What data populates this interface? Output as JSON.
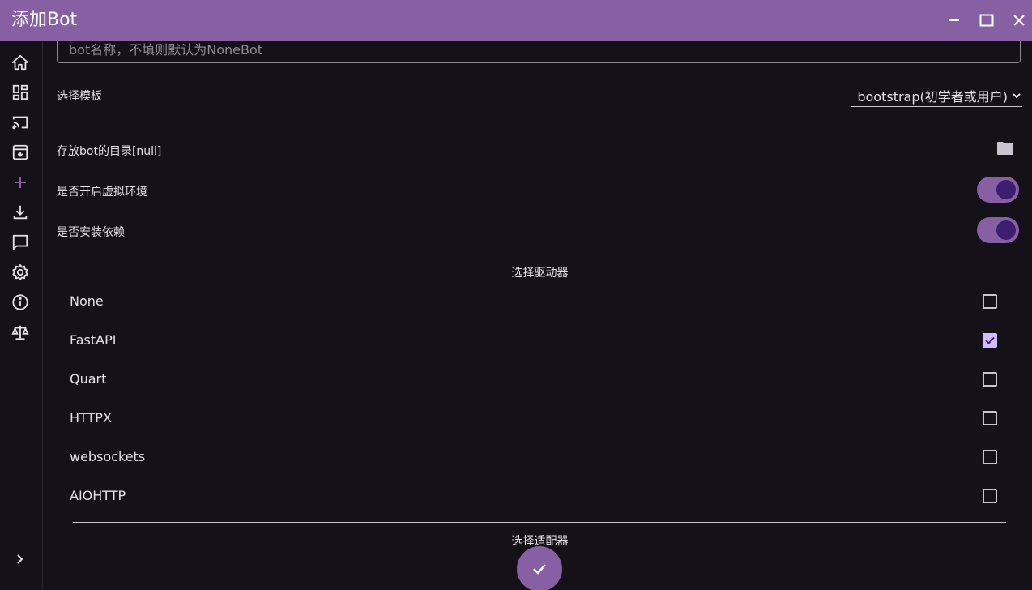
{
  "window": {
    "title": "添加Bot",
    "minimize_icon": "minimize-icon",
    "maximize_icon": "maximize-icon",
    "close_icon": "close-icon"
  },
  "sidebar": {
    "items": [
      {
        "icon": "home-icon"
      },
      {
        "icon": "dashboard-icon"
      },
      {
        "icon": "cast-icon"
      },
      {
        "icon": "archive-icon"
      },
      {
        "icon": "add-icon",
        "active": true
      },
      {
        "icon": "download-icon"
      },
      {
        "icon": "chat-icon"
      },
      {
        "icon": "settings-icon"
      },
      {
        "icon": "info-icon"
      },
      {
        "icon": "balance-icon"
      }
    ],
    "expand_icon": "chevron-right-icon"
  },
  "form": {
    "name_placeholder": "bot名称，不填则默认为NoneBot",
    "name_value": "",
    "template_label": "选择模板",
    "template_value": "bootstrap(初学者或用户)",
    "dir_label": "存放bot的目录[null]",
    "venv_label": "是否开启虚拟环境",
    "venv_enabled": true,
    "deps_label": "是否安装依赖",
    "deps_enabled": true,
    "driver_section": "选择驱动器",
    "drivers": [
      {
        "name": "None",
        "checked": false
      },
      {
        "name": "FastAPI",
        "checked": true
      },
      {
        "name": "Quart",
        "checked": false
      },
      {
        "name": "HTTPX",
        "checked": false
      },
      {
        "name": "websockets",
        "checked": false
      },
      {
        "name": "AIOHTTP",
        "checked": false
      }
    ],
    "adapter_section": "选择适配器"
  },
  "colors": {
    "accent": "#8660a3",
    "background": "#141218",
    "checkbox_checked": "#d0bcff"
  }
}
